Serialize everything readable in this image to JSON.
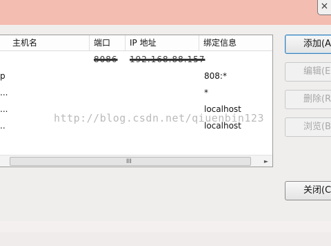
{
  "window": {
    "close_glyph": "×"
  },
  "list": {
    "columns": {
      "hostname": "主机名",
      "port": "端口",
      "ip": "IP 地址",
      "binding": "绑定信息"
    },
    "rows": [
      {
        "name": "",
        "port": "8086",
        "ip": "192.168.88.157",
        "binding": ""
      },
      {
        "name": "p",
        "port": "",
        "ip": "",
        "binding": "808:*"
      },
      {
        "name": "...",
        "port": "",
        "ip": "",
        "binding": "*"
      },
      {
        "name": "...",
        "port": "",
        "ip": "",
        "binding": "localhost"
      },
      {
        "name": "..",
        "port": "",
        "ip": "",
        "binding": "localhost"
      }
    ]
  },
  "scrollbar": {
    "grip": "III",
    "right_arrow": "►"
  },
  "buttons": {
    "add": "添加(A)",
    "edit": "编辑(E)",
    "remove": "删除(R)",
    "browse": "浏览(B)",
    "close": "关闭(C)"
  },
  "watermark": "http://blog.csdn.net/qiuenbin123"
}
